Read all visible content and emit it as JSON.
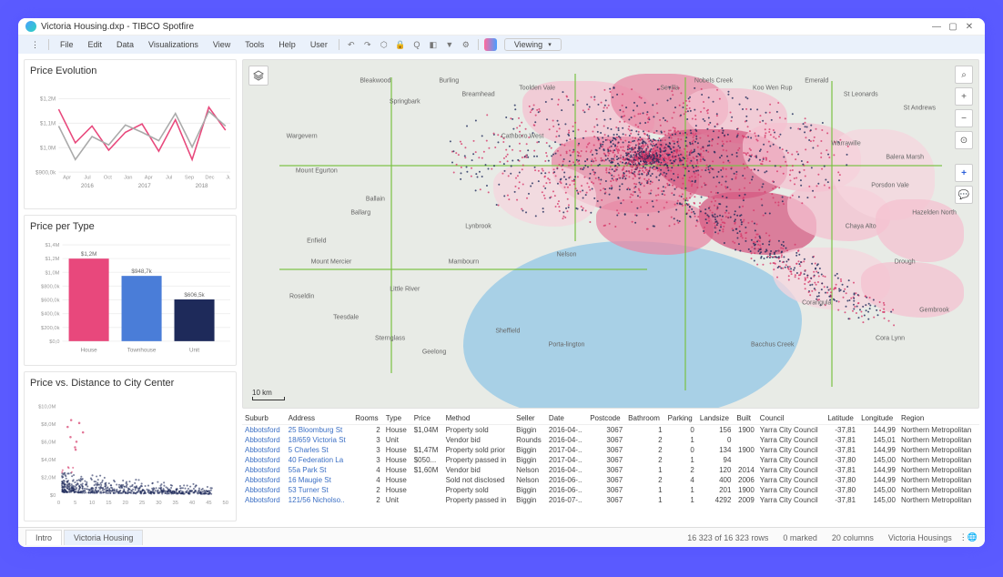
{
  "window": {
    "title": "Victoria Housing.dxp - TIBCO Spotfire"
  },
  "menu": {
    "items": [
      "File",
      "Edit",
      "Data",
      "Visualizations",
      "View",
      "Tools",
      "Help",
      "User"
    ],
    "viewing": "Viewing"
  },
  "panels": {
    "priceEvolution": {
      "title": "Price Evolution"
    },
    "pricePerType": {
      "title": "Price per Type"
    },
    "scatter": {
      "title": "Price vs. Distance to City Center"
    }
  },
  "chart_data": [
    {
      "type": "line",
      "title": "Price Evolution",
      "xlabel": "",
      "ylabel": "",
      "x_ticks": [
        "Apr",
        "Jul",
        "Oct",
        "Jan",
        "Apr",
        "Jul",
        "Sep",
        "Dec",
        "Jun"
      ],
      "x_year_labels": [
        "2016",
        "2017",
        "2018"
      ],
      "y_ticks": [
        "$900,0k",
        "$1,0M",
        "$1,1M",
        "$1,2M"
      ],
      "ylim": [
        900000,
        1250000
      ],
      "series": [
        {
          "name": "series_pink",
          "values": [
            1200000,
            1040000,
            1120000,
            1005000,
            1090000,
            1130000,
            1000000,
            1150000,
            960000,
            1210000,
            1100000
          ]
        },
        {
          "name": "series_gray",
          "values": [
            1120000,
            960000,
            1070000,
            1030000,
            1125000,
            1090000,
            1050000,
            1180000,
            1020000,
            1190000,
            1120000
          ]
        }
      ]
    },
    {
      "type": "bar",
      "title": "Price per Type",
      "categories": [
        "House",
        "Townhouse",
        "Unit"
      ],
      "values": [
        1200000,
        948700,
        606500
      ],
      "value_labels": [
        "$1,2M",
        "$948,7k",
        "$606,5k"
      ],
      "colors": [
        "#e8487c",
        "#4a7dd8",
        "#1e2a5a"
      ],
      "y_ticks": [
        "$0,0",
        "$200,0k",
        "$400,0k",
        "$600,0k",
        "$800,0k",
        "$1,0M",
        "$1,2M",
        "$1,4M"
      ],
      "ylim": [
        0,
        1400000
      ]
    },
    {
      "type": "scatter",
      "title": "Price vs. Distance to City Center",
      "xlabel": "",
      "ylabel": "",
      "x_ticks": [
        "0",
        "5",
        "10",
        "15",
        "20",
        "25",
        "30",
        "35",
        "40",
        "45",
        "50"
      ],
      "y_ticks": [
        "$0",
        "$2,0M",
        "$4,0M",
        "$6,0M",
        "$8,0M",
        "$10,0M"
      ],
      "xlim": [
        0,
        50
      ],
      "ylim": [
        0,
        10000000
      ],
      "note": "dense cluster of points near x=2..15, y<4M; sparse high-y outliers near x<10"
    }
  ],
  "map": {
    "scale": "10 km",
    "places": [
      "Bleakwood",
      "Burling",
      "Springbark",
      "Wargevern",
      "Mount Egurton",
      "Ballain",
      "Ballarg",
      "Enfield",
      "Mount Mercier",
      "Roseldin",
      "Teesdale",
      "Sternglass",
      "Geelong",
      "Breamhead",
      "Toolden Vale",
      "Cathboro West",
      "Lynbrook",
      "Mambourn",
      "Little River",
      "Sheffield",
      "Porta-lington",
      "St Leonards",
      "Emerald",
      "St Andrews",
      "Warrawille",
      "Porsdon Vale",
      "Hazelden North",
      "Drough",
      "Gembrook",
      "Cora Lynn",
      "Koo Wen Rup",
      "Nobels Creek",
      "Sevilla",
      "Balera Marsh",
      "Chaya Alto",
      "Corangula",
      "Bacchus Creek",
      "Nelson"
    ]
  },
  "table": {
    "columns": [
      "Suburb",
      "Address",
      "Rooms",
      "Type",
      "Price",
      "Method",
      "Seller",
      "Date",
      "Postcode",
      "Bathroom",
      "Parking",
      "Landsize",
      "Built",
      "Council",
      "Latitude",
      "Longitude",
      "Region"
    ],
    "rows": [
      [
        "Abbotsford",
        "25 Bloomburg St",
        "2",
        "House",
        "$1,04M",
        "Property sold",
        "Biggin",
        "2016-04-..",
        "3067",
        "1",
        "0",
        "156",
        "1900",
        "Yarra City Council",
        "-37,81",
        "144,99",
        "Northern Metropolitan"
      ],
      [
        "Abbotsford",
        "18/659 Victoria St",
        "3",
        "Unit",
        "",
        "Vendor bid",
        "Rounds",
        "2016-04-..",
        "3067",
        "2",
        "1",
        "0",
        "",
        "Yarra City Council",
        "-37,81",
        "145,01",
        "Northern Metropolitan"
      ],
      [
        "Abbotsford",
        "5 Charles St",
        "3",
        "House",
        "$1,47M",
        "Property sold prior",
        "Biggin",
        "2017-04-..",
        "3067",
        "2",
        "0",
        "134",
        "1900",
        "Yarra City Council",
        "-37,81",
        "144,99",
        "Northern Metropolitan"
      ],
      [
        "Abbotsford",
        "40 Federation La",
        "3",
        "House",
        "$050...",
        "Property passed in",
        "Biggin",
        "2017-04-..",
        "3067",
        "2",
        "1",
        "94",
        "",
        "Yarra City Council",
        "-37,80",
        "145,00",
        "Northern Metropolitan"
      ],
      [
        "Abbotsford",
        "55a Park St",
        "4",
        "House",
        "$1,60M",
        "Vendor bid",
        "Nelson",
        "2016-04-..",
        "3067",
        "1",
        "2",
        "120",
        "2014",
        "Yarra City Council",
        "-37,81",
        "144,99",
        "Northern Metropolitan"
      ],
      [
        "Abbotsford",
        "16 Maugie St",
        "4",
        "House",
        "",
        "Sold not disclosed",
        "Nelson",
        "2016-06-..",
        "3067",
        "2",
        "4",
        "400",
        "2006",
        "Yarra City Council",
        "-37,80",
        "144,99",
        "Northern Metropolitan"
      ],
      [
        "Abbotsford",
        "53 Turner St",
        "2",
        "House",
        "",
        "Property sold",
        "Biggin",
        "2016-06-..",
        "3067",
        "1",
        "1",
        "201",
        "1900",
        "Yarra City Council",
        "-37,80",
        "145,00",
        "Northern Metropolitan"
      ],
      [
        "Abbotsford",
        "121/56 Nicholso..",
        "2",
        "Unit",
        "",
        "Property passed in",
        "Biggin",
        "2016-07-..",
        "3067",
        "1",
        "1",
        "4292",
        "2009",
        "Yarra City Council",
        "-37,81",
        "145,00",
        "Northern Metropolitan"
      ]
    ]
  },
  "footer": {
    "tabs": [
      "Intro",
      "Victoria Housing"
    ],
    "rows": "16 323 of 16 323 rows",
    "marked": "0 marked",
    "columns": "20 columns",
    "dataset": "Victoria Housings"
  }
}
